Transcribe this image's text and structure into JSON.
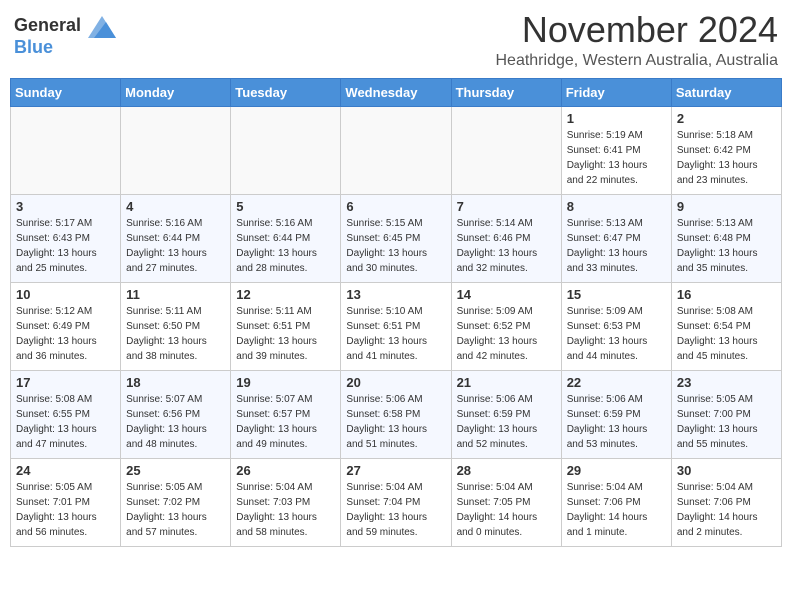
{
  "header": {
    "logo_general": "General",
    "logo_blue": "Blue",
    "month": "November 2024",
    "location": "Heathridge, Western Australia, Australia"
  },
  "weekdays": [
    "Sunday",
    "Monday",
    "Tuesday",
    "Wednesday",
    "Thursday",
    "Friday",
    "Saturday"
  ],
  "weeks": [
    [
      {
        "day": "",
        "info": ""
      },
      {
        "day": "",
        "info": ""
      },
      {
        "day": "",
        "info": ""
      },
      {
        "day": "",
        "info": ""
      },
      {
        "day": "",
        "info": ""
      },
      {
        "day": "1",
        "info": "Sunrise: 5:19 AM\nSunset: 6:41 PM\nDaylight: 13 hours\nand 22 minutes."
      },
      {
        "day": "2",
        "info": "Sunrise: 5:18 AM\nSunset: 6:42 PM\nDaylight: 13 hours\nand 23 minutes."
      }
    ],
    [
      {
        "day": "3",
        "info": "Sunrise: 5:17 AM\nSunset: 6:43 PM\nDaylight: 13 hours\nand 25 minutes."
      },
      {
        "day": "4",
        "info": "Sunrise: 5:16 AM\nSunset: 6:44 PM\nDaylight: 13 hours\nand 27 minutes."
      },
      {
        "day": "5",
        "info": "Sunrise: 5:16 AM\nSunset: 6:44 PM\nDaylight: 13 hours\nand 28 minutes."
      },
      {
        "day": "6",
        "info": "Sunrise: 5:15 AM\nSunset: 6:45 PM\nDaylight: 13 hours\nand 30 minutes."
      },
      {
        "day": "7",
        "info": "Sunrise: 5:14 AM\nSunset: 6:46 PM\nDaylight: 13 hours\nand 32 minutes."
      },
      {
        "day": "8",
        "info": "Sunrise: 5:13 AM\nSunset: 6:47 PM\nDaylight: 13 hours\nand 33 minutes."
      },
      {
        "day": "9",
        "info": "Sunrise: 5:13 AM\nSunset: 6:48 PM\nDaylight: 13 hours\nand 35 minutes."
      }
    ],
    [
      {
        "day": "10",
        "info": "Sunrise: 5:12 AM\nSunset: 6:49 PM\nDaylight: 13 hours\nand 36 minutes."
      },
      {
        "day": "11",
        "info": "Sunrise: 5:11 AM\nSunset: 6:50 PM\nDaylight: 13 hours\nand 38 minutes."
      },
      {
        "day": "12",
        "info": "Sunrise: 5:11 AM\nSunset: 6:51 PM\nDaylight: 13 hours\nand 39 minutes."
      },
      {
        "day": "13",
        "info": "Sunrise: 5:10 AM\nSunset: 6:51 PM\nDaylight: 13 hours\nand 41 minutes."
      },
      {
        "day": "14",
        "info": "Sunrise: 5:09 AM\nSunset: 6:52 PM\nDaylight: 13 hours\nand 42 minutes."
      },
      {
        "day": "15",
        "info": "Sunrise: 5:09 AM\nSunset: 6:53 PM\nDaylight: 13 hours\nand 44 minutes."
      },
      {
        "day": "16",
        "info": "Sunrise: 5:08 AM\nSunset: 6:54 PM\nDaylight: 13 hours\nand 45 minutes."
      }
    ],
    [
      {
        "day": "17",
        "info": "Sunrise: 5:08 AM\nSunset: 6:55 PM\nDaylight: 13 hours\nand 47 minutes."
      },
      {
        "day": "18",
        "info": "Sunrise: 5:07 AM\nSunset: 6:56 PM\nDaylight: 13 hours\nand 48 minutes."
      },
      {
        "day": "19",
        "info": "Sunrise: 5:07 AM\nSunset: 6:57 PM\nDaylight: 13 hours\nand 49 minutes."
      },
      {
        "day": "20",
        "info": "Sunrise: 5:06 AM\nSunset: 6:58 PM\nDaylight: 13 hours\nand 51 minutes."
      },
      {
        "day": "21",
        "info": "Sunrise: 5:06 AM\nSunset: 6:59 PM\nDaylight: 13 hours\nand 52 minutes."
      },
      {
        "day": "22",
        "info": "Sunrise: 5:06 AM\nSunset: 6:59 PM\nDaylight: 13 hours\nand 53 minutes."
      },
      {
        "day": "23",
        "info": "Sunrise: 5:05 AM\nSunset: 7:00 PM\nDaylight: 13 hours\nand 55 minutes."
      }
    ],
    [
      {
        "day": "24",
        "info": "Sunrise: 5:05 AM\nSunset: 7:01 PM\nDaylight: 13 hours\nand 56 minutes."
      },
      {
        "day": "25",
        "info": "Sunrise: 5:05 AM\nSunset: 7:02 PM\nDaylight: 13 hours\nand 57 minutes."
      },
      {
        "day": "26",
        "info": "Sunrise: 5:04 AM\nSunset: 7:03 PM\nDaylight: 13 hours\nand 58 minutes."
      },
      {
        "day": "27",
        "info": "Sunrise: 5:04 AM\nSunset: 7:04 PM\nDaylight: 13 hours\nand 59 minutes."
      },
      {
        "day": "28",
        "info": "Sunrise: 5:04 AM\nSunset: 7:05 PM\nDaylight: 14 hours\nand 0 minutes."
      },
      {
        "day": "29",
        "info": "Sunrise: 5:04 AM\nSunset: 7:06 PM\nDaylight: 14 hours\nand 1 minute."
      },
      {
        "day": "30",
        "info": "Sunrise: 5:04 AM\nSunset: 7:06 PM\nDaylight: 14 hours\nand 2 minutes."
      }
    ]
  ]
}
